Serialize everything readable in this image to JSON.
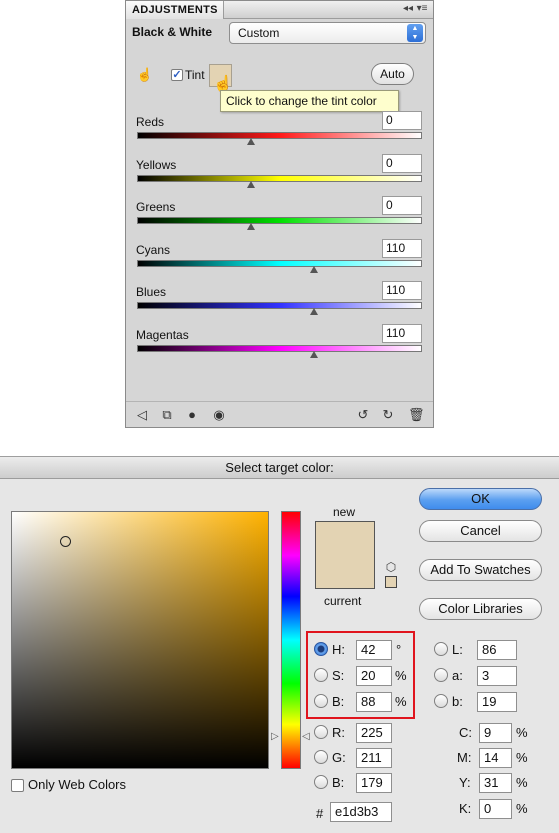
{
  "adjustments": {
    "tab_title": "ADJUSTMENTS",
    "collapse_glyph": "◂◂",
    "menu_glyph": "▾≡",
    "preset_label": "Black & White",
    "preset_value": "Custom",
    "tint_label": "Tint",
    "tint_checked": true,
    "tint_color": "#e3d3b3",
    "auto_label": "Auto",
    "tooltip": "Click to change the tint color",
    "channels": [
      {
        "label": "Reds",
        "value": "0",
        "gradient": [
          "#000000",
          "#ff1a1a"
        ]
      },
      {
        "label": "Yellows",
        "value": "0",
        "gradient": [
          "#000000",
          "#ffff00"
        ]
      },
      {
        "label": "Greens",
        "value": "0",
        "gradient": [
          "#000000",
          "#00e000"
        ]
      },
      {
        "label": "Cyans",
        "value": "110",
        "gradient": [
          "#000000",
          "#00ffff"
        ]
      },
      {
        "label": "Blues",
        "value": "110",
        "gradient": [
          "#000000",
          "#3232ff"
        ]
      },
      {
        "label": "Magentas",
        "value": "110",
        "gradient": [
          "#000000",
          "#ff00ff"
        ]
      }
    ],
    "slider_range": [
      -200,
      300
    ],
    "footer_icons": [
      "back-arrow-icon",
      "clip-layer-icon",
      "visibility-layer-icon",
      "eye-icon",
      "previous-state-icon",
      "reset-icon",
      "trash-icon"
    ]
  },
  "picker": {
    "title": "Select target color:",
    "new_label": "new",
    "current_label": "current",
    "new_color": "#e3d3b3",
    "current_color": "#e3d3b3",
    "hue_color": "#ffb200",
    "only_web_colors_label": "Only Web Colors",
    "only_web_colors_checked": false,
    "buttons": {
      "ok": "OK",
      "cancel": "Cancel",
      "add_to_swatches": "Add To Swatches",
      "color_libraries": "Color Libraries"
    },
    "hsb": {
      "h": {
        "label": "H:",
        "value": "42",
        "unit": "°",
        "selected": true
      },
      "s": {
        "label": "S:",
        "value": "20",
        "unit": "%",
        "selected": false
      },
      "b": {
        "label": "B:",
        "value": "88",
        "unit": "%",
        "selected": false
      }
    },
    "rgb": {
      "r": {
        "label": "R:",
        "value": "225"
      },
      "g": {
        "label": "G:",
        "value": "211"
      },
      "b": {
        "label": "B:",
        "value": "179"
      }
    },
    "lab": {
      "l": {
        "label": "L:",
        "value": "86"
      },
      "a": {
        "label": "a:",
        "value": "3"
      },
      "b": {
        "label": "b:",
        "value": "19"
      }
    },
    "cmyk": {
      "c": {
        "label": "C:",
        "value": "9",
        "unit": "%"
      },
      "m": {
        "label": "M:",
        "value": "14",
        "unit": "%"
      },
      "y": {
        "label": "Y:",
        "value": "31",
        "unit": "%"
      },
      "k": {
        "label": "K:",
        "value": "0",
        "unit": "%"
      }
    },
    "hex": {
      "label": "#",
      "value": "e1d3b3"
    }
  }
}
